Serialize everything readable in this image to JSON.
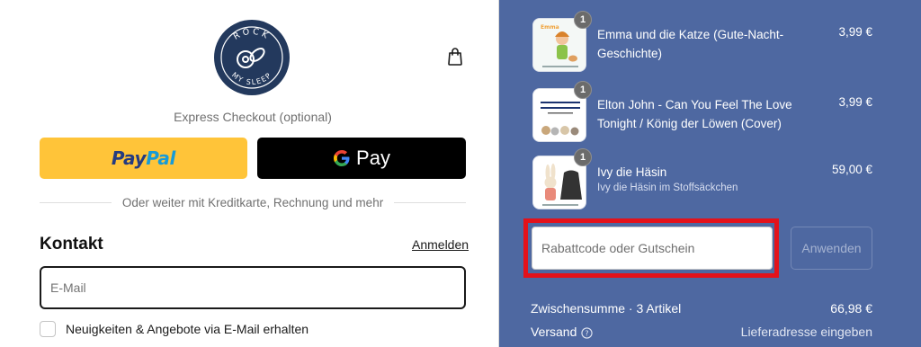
{
  "brand": {
    "logo_top": "ROCK",
    "logo_bottom": "MY SLEEP"
  },
  "express": {
    "label": "Express Checkout (optional)",
    "paypal_part1": "Pay",
    "paypal_part2": "Pal",
    "gpay_label": "Pay"
  },
  "divider_text": "Oder weiter mit Kreditkarte, Rechnung und mehr",
  "contact": {
    "title": "Kontakt",
    "login_link": "Anmelden",
    "email_placeholder": "E-Mail",
    "newsletter_label": "Neuigkeiten & Angebote via E-Mail erhalten"
  },
  "cart": {
    "items": [
      {
        "title": "Emma und die Katze (Gute-Nacht-Geschichte)",
        "subtitle": "",
        "price": "3,99 €",
        "quantity": "1"
      },
      {
        "title": "Elton John - Can You Feel The Love Tonight / König der Löwen (Cover)",
        "subtitle": "",
        "price": "3,99 €",
        "quantity": "1"
      },
      {
        "title": "Ivy die Häsin",
        "subtitle": "Ivy die Häsin im Stoffsäckchen",
        "price": "59,00 €",
        "quantity": "1"
      }
    ],
    "discount_placeholder": "Rabattcode oder Gutschein",
    "apply_label": "Anwenden",
    "subtotal_label": "Zwischensumme · 3 Artikel",
    "subtotal_value": "66,98 €",
    "shipping_label": "Versand",
    "shipping_value": "Lieferadresse eingeben"
  },
  "colors": {
    "sidebar_bg": "#4e68a1",
    "paypal_yellow": "#ffc439",
    "highlight_red": "#e3121b",
    "logo_navy": "#23395d"
  },
  "icons": [
    "bag-icon",
    "google-g-icon",
    "help-icon"
  ]
}
